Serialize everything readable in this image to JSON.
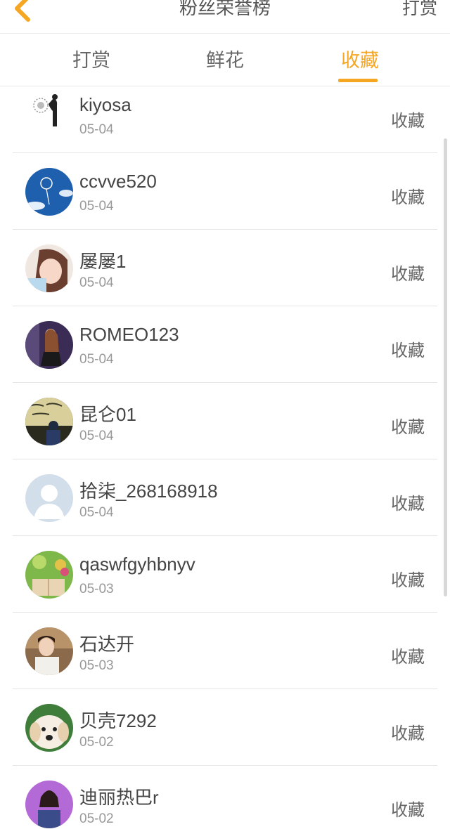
{
  "header": {
    "title": "粉丝荣誉榜",
    "right_action": "打赏",
    "back_icon": "chevron-left-icon",
    "accent_color": "#f5a623"
  },
  "tabs": [
    {
      "label": "打赏",
      "active": false
    },
    {
      "label": "鲜花",
      "active": false
    },
    {
      "label": "收藏",
      "active": true
    }
  ],
  "list": [
    {
      "name": "kiyosa",
      "date": "05-04",
      "action": "收藏",
      "avatar": "dandelion-silhouette-avatar"
    },
    {
      "name": "ccvve520",
      "date": "05-04",
      "action": "收藏",
      "avatar": "blue-sky-dandelion-avatar"
    },
    {
      "name": "屡屡1",
      "date": "05-04",
      "action": "收藏",
      "avatar": "girl-portrait-avatar"
    },
    {
      "name": "ROMEO123",
      "date": "05-04",
      "action": "收藏",
      "avatar": "street-girl-avatar"
    },
    {
      "name": "昆仑01",
      "date": "05-04",
      "action": "收藏",
      "avatar": "chalkboard-person-avatar"
    },
    {
      "name": "拾柒_268168918",
      "date": "05-04",
      "action": "收藏",
      "avatar": "default-user-avatar"
    },
    {
      "name": "qaswfgyhbnyv",
      "date": "05-03",
      "action": "收藏",
      "avatar": "green-book-avatar"
    },
    {
      "name": "石达开",
      "date": "05-03",
      "action": "收藏",
      "avatar": "boy-portrait-avatar"
    },
    {
      "name": "贝壳7292",
      "date": "05-02",
      "action": "收藏",
      "avatar": "puppy-avatar"
    },
    {
      "name": "迪丽热巴r",
      "date": "05-02",
      "action": "收藏",
      "avatar": "purple-girl-avatar"
    }
  ]
}
